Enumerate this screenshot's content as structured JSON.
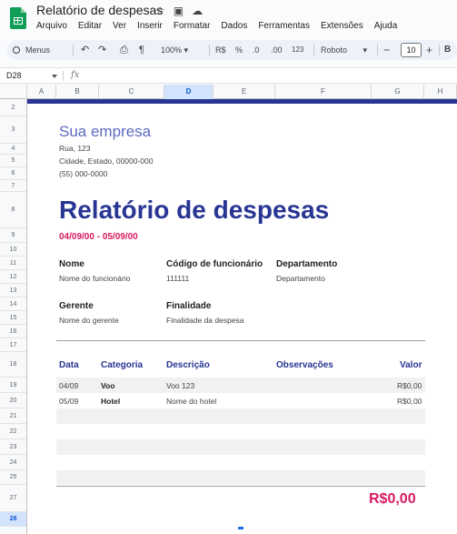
{
  "app": {
    "document_title": "Relatório de despesas",
    "menu": [
      "Arquivo",
      "Editar",
      "Ver",
      "Inserir",
      "Formatar",
      "Dados",
      "Ferramentas",
      "Extensões",
      "Ajuda"
    ]
  },
  "toolbar": {
    "menus_label": "Menus",
    "zoom": "100%",
    "currency": "R$",
    "percent": "%",
    "decimal_decrease": ".0",
    "decimal_increase": ".00",
    "number_format": "123",
    "font": "Roboto",
    "minus": "−",
    "font_size": "10",
    "plus": "+",
    "bold": "B"
  },
  "formula_bar": {
    "cell_ref": "D28",
    "fx": "fx"
  },
  "grid": {
    "columns": [
      "A",
      "B",
      "C",
      "D",
      "E",
      "F",
      "G",
      "H"
    ],
    "selected_column": "D",
    "rows": [
      "2",
      "3",
      "4",
      "5",
      "6",
      "7",
      "8",
      "9",
      "10",
      "11",
      "12",
      "13",
      "14",
      "15",
      "16",
      "17",
      "18",
      "19",
      "20",
      "21",
      "22",
      "23",
      "24",
      "25",
      "27",
      "28"
    ],
    "selected_row": "28"
  },
  "sheet": {
    "company": "Sua empresa",
    "address": [
      "Rua, 123",
      "Cidade, Estado, 00000-000",
      "(55) 000-0000"
    ],
    "title": "Relatório de despesas",
    "date_range": "04/09/00 - 05/09/00",
    "name_label": "Nome",
    "name_value": "Nome do funcionário",
    "employee_code_label": "Código de funcionário",
    "employee_code_value": "111111",
    "department_label": "Departamento",
    "department_value": "Departamento",
    "manager_label": "Gerente",
    "manager_value": "Nome do gerente",
    "purpose_label": "Finalidade",
    "purpose_value": "Finalidade da despesa",
    "table_headers": {
      "date": "Data",
      "category": "Categoria",
      "description": "Descrição",
      "notes": "Observações",
      "value": "Valor"
    },
    "rows": [
      {
        "date": "04/09",
        "category": "Voo",
        "description": "Voo 123",
        "value": "R$0,00"
      },
      {
        "date": "05/09",
        "category": "Hotel",
        "description": "Nome do hotel",
        "value": "R$0,00"
      }
    ],
    "total": "R$0,00"
  },
  "colors": {
    "navy": "#283593",
    "company_purple": "#5c6bc0",
    "accent_pink": "#d81b60",
    "sheets_green": "#0f9d58"
  }
}
